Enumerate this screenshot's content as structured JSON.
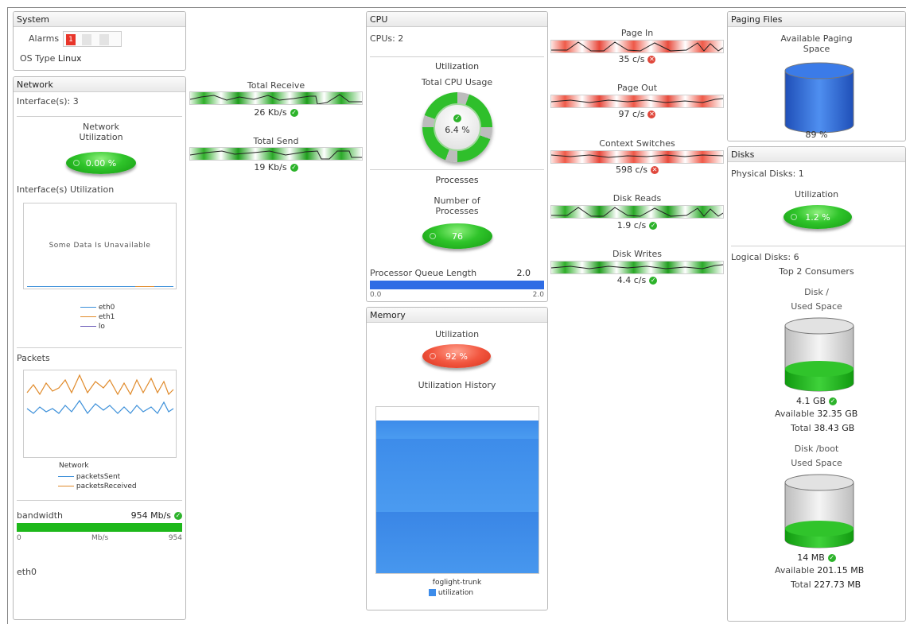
{
  "system": {
    "title": "System",
    "alarms_label": "Alarms",
    "alarm_count": "1",
    "os_type_label": "OS Type",
    "os_type_value": "Linux"
  },
  "network": {
    "title": "Network",
    "interfaces": "Interface(s): 3",
    "utilization_label_1": "Network",
    "utilization_label_2": "Utilization",
    "utilization_value": "0.00 %",
    "interfaces_utilization_title": "Interface(s) Utilization",
    "unavailable_text": "Some Data Is Unavailable",
    "legend": [
      {
        "name": "eth0",
        "color": "#3b8fd9"
      },
      {
        "name": "eth1",
        "color": "#e08a2a"
      },
      {
        "name": "lo",
        "color": "#6a5ab8"
      }
    ],
    "packets_title": "Packets",
    "packets_chart_title": "Network",
    "packets_legend": [
      {
        "name": "packetsSent",
        "color": "#3b8fd9"
      },
      {
        "name": "packetsReceived",
        "color": "#e08a2a"
      }
    ],
    "bandwidth_label": "bandwidth",
    "bandwidth_value": "954 Mb/s",
    "bandwidth_min": "0",
    "bandwidth_unit": "Mb/s",
    "bandwidth_max": "954",
    "bandwidth_fraction": 1.0,
    "interface_name": "eth0"
  },
  "traffic": {
    "receive_label": "Total Receive",
    "receive_value": "26 Kb/s",
    "send_label": "Total Send",
    "send_value": "19 Kb/s"
  },
  "cpu": {
    "title": "CPU",
    "cpus": "CPUs: 2",
    "utilization_section": "Utilization",
    "total_usage_label": "Total CPU Usage",
    "total_usage_value": "6.4 %",
    "processes_section": "Processes",
    "num_processes_label_1": "Number of",
    "num_processes_label_2": "Processes",
    "num_processes_value": "76",
    "queue_label": "Processor Queue Length",
    "queue_value": "2.0",
    "queue_min": "0.0",
    "queue_max": "2.0",
    "queue_fraction": 1.0
  },
  "memory": {
    "title": "Memory",
    "utilization_label": "Utilization",
    "utilization_value": "92 %",
    "history_label": "Utilization History",
    "chart_host": "foglight-trunk",
    "chart_legend": "utilization",
    "utilization_fraction": 0.92
  },
  "paging_metrics": [
    {
      "label": "Page In",
      "value": "35 c/s",
      "status": "error"
    },
    {
      "label": "Page Out",
      "value": "97 c/s",
      "status": "error"
    },
    {
      "label": "Context Switches",
      "value": "598 c/s",
      "status": "error"
    },
    {
      "label": "Disk Reads",
      "value": "1.9 c/s",
      "status": "ok"
    },
    {
      "label": "Disk Writes",
      "value": "4.4 c/s",
      "status": "ok"
    }
  ],
  "paging_files": {
    "title": "Paging Files",
    "available_label_1": "Available Paging",
    "available_label_2": "Space",
    "available_value": "89 %",
    "available_fraction": 0.89
  },
  "disks": {
    "title": "Disks",
    "physical_disks": "Physical Disks: 1",
    "utilization_label": "Utilization",
    "utilization_value": "1.2 %",
    "logical_disks": "Logical Disks: 6",
    "top_consumers": "Top 2 Consumers",
    "consumers": [
      {
        "name": "Disk /",
        "used_space_label": "Used Space",
        "used_value": "4.1 GB",
        "available_label": "Available",
        "available_value": "32.35 GB",
        "total_label": "Total",
        "total_value": "38.43 GB",
        "used_fraction": 0.11
      },
      {
        "name": "Disk /boot",
        "used_space_label": "Used Space",
        "used_value": "14 MB",
        "available_label": "Available",
        "available_value": "201.15 MB",
        "total_label": "Total",
        "total_value": "227.73 MB",
        "used_fraction": 0.06
      }
    ]
  }
}
